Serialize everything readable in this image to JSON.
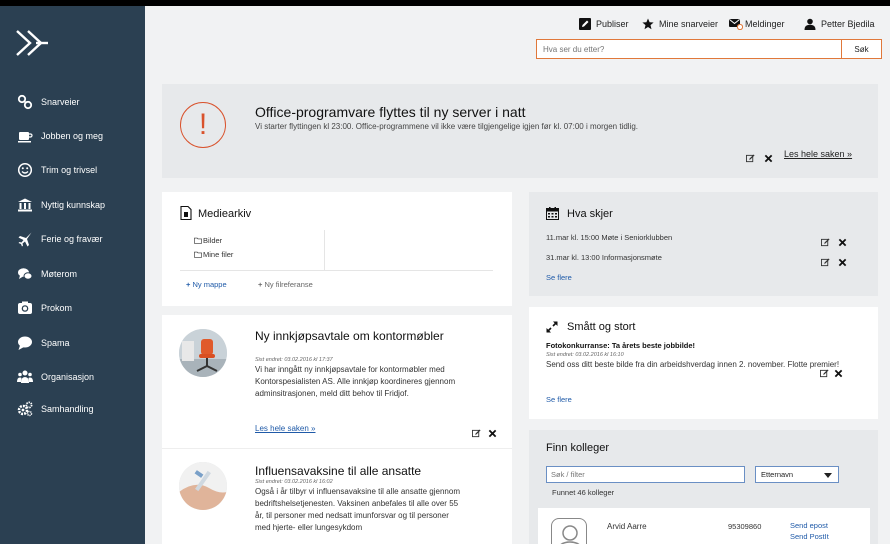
{
  "sidebar": {
    "items": [
      {
        "label": "Snarveier",
        "icon": "link-icon"
      },
      {
        "label": "Jobben og meg",
        "icon": "coffee-icon"
      },
      {
        "label": "Trim og trivsel",
        "icon": "smile-icon"
      },
      {
        "label": "Nyttig kunnskap",
        "icon": "bank-icon"
      },
      {
        "label": "Ferie og fravær",
        "icon": "plane-icon"
      },
      {
        "label": "Møterom",
        "icon": "chat-icon"
      },
      {
        "label": "Prokom",
        "icon": "camera-icon"
      },
      {
        "label": "Spama",
        "icon": "speech-icon"
      },
      {
        "label": "Organisasjon",
        "icon": "people-icon"
      },
      {
        "label": "Samhandling",
        "icon": "cogs-icon"
      }
    ]
  },
  "header": {
    "publish": "Publiser",
    "shortcuts": "Mine snarveier",
    "messages": "Meldinger",
    "user": "Petter Bjedila",
    "search_placeholder": "Hva ser du etter?",
    "search_button": "Søk"
  },
  "alert": {
    "title": "Office-programvare flyttes til ny server i natt",
    "text": "Vi starter flyttingen kl 23:00. Office-programmene vil ikke være tilgjengelige igjen før kl. 07:00 i morgen tidlig.",
    "read_more": "Les hele saken »"
  },
  "media": {
    "title": "Mediearkiv",
    "folders": [
      "Bilder",
      "Mine filer"
    ],
    "new_folder": "Ny mappe",
    "new_fileref": "Ny filreferanse"
  },
  "news": [
    {
      "title": "Ny innkjøpsavtale om kontormøbler",
      "meta": "Sist endret: 03.02.2016 kl 17:37",
      "body": "Vi har inngått ny innkjøpsavtale for kontormøbler med Kontorspesialisten AS. Alle innkjøp koordineres gjennom adminsitrasjonen, meld ditt behov til Fridjof.",
      "read_more": "Les hele saken »"
    },
    {
      "title": "Influensavaksine til alle ansatte",
      "meta": "Sist endret: 03.02.2016 kl 16:02",
      "body": "Også i år tilbyr vi influensavaksine til alle ansatte gjennom bedriftshelsetjenesten. Vaksinen anbefales til alle over 55 år, til personer med nedsatt imunforsvar og til personer med hjerte- eller lungesykdom"
    }
  ],
  "events": {
    "title": "Hva skjer",
    "items": [
      {
        "date": "11.mar kl. 15:00",
        "name": "Møte i Seniorklubben"
      },
      {
        "date": "31.mar kl. 13:00",
        "name": "Informasjonsmøte"
      }
    ],
    "more": "Se flere"
  },
  "small": {
    "title": "Smått og stort",
    "headline": "Fotokonkurranse: Ta årets beste jobbilde!",
    "meta": "Sist endret: 03.02.2016 kl 16:10",
    "body": "Send oss ditt beste bilde fra din arbeidshverdag innen 2. november. Flotte premier!",
    "more": "Se flere"
  },
  "colleagues": {
    "title": "Finn kolleger",
    "filter_placeholder": "Søk / filter",
    "sort": "Etternavn",
    "count": "Funnet 46 kolleger",
    "person": {
      "name": "Arvid Aarre",
      "phone": "95309860",
      "email": "Send epost",
      "postit": "Send PostIt"
    }
  }
}
